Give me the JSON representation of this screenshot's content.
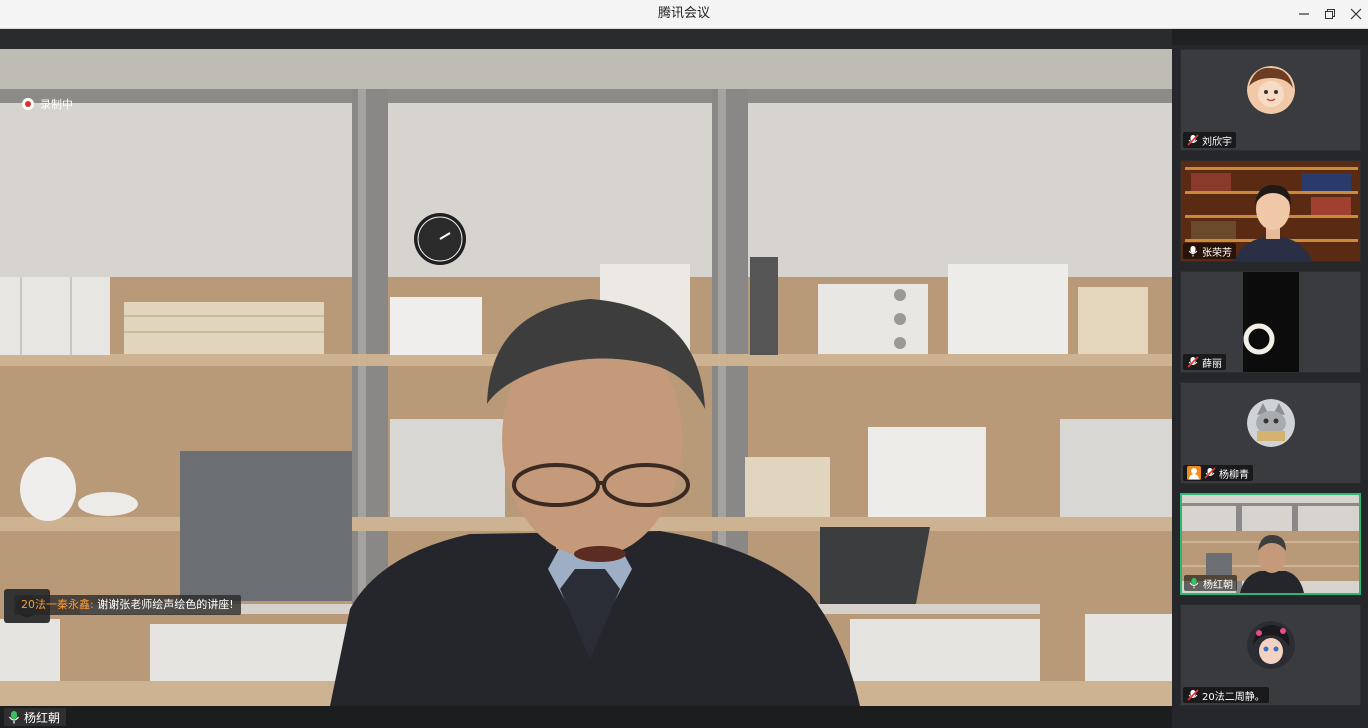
{
  "window": {
    "title": "腾讯会议",
    "controls": [
      "minimize-icon",
      "restore-icon",
      "close-icon"
    ]
  },
  "main": {
    "recording_label": "录制中",
    "chat": {
      "sender": "20法一秦永鑫:",
      "message": "谢谢张老师绘声绘色的讲座!"
    },
    "active_speaker": "杨红朝"
  },
  "participants": [
    {
      "name": "刘欣宇",
      "mic": "muted",
      "video": false,
      "avatar": "girl-avatar"
    },
    {
      "name": "张荣芳",
      "mic": "on",
      "video": true
    },
    {
      "name": "薛丽",
      "mic": "muted",
      "video": true
    },
    {
      "name": "杨柳青",
      "mic": "muted",
      "video": false,
      "avatar": "cat-avatar",
      "host": true
    },
    {
      "name": "杨红朝",
      "mic": "on",
      "video": true,
      "speaking": true
    },
    {
      "name": "20法二周静。",
      "mic": "muted",
      "video": false,
      "avatar": "cartoon-avatar"
    }
  ],
  "colors": {
    "speaking_border": "#2bb673",
    "chat_sender": "#ff9a2e",
    "host_badge": "#f08c1e",
    "record_dot": "#e0302a"
  }
}
